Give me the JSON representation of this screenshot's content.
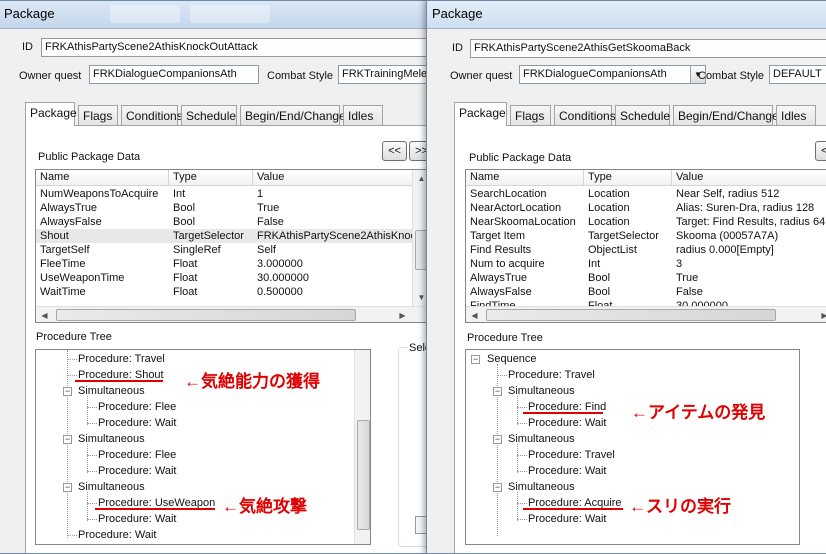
{
  "left": {
    "title": "Package",
    "id_label": "ID",
    "id_value": "FRKAthisPartyScene2AthisKnockOutAttack",
    "owner_label": "Owner quest",
    "owner_value": "FRKDialogueCompanionsAth",
    "combat_label": "Combat Style",
    "combat_value": "FRKTrainingMelee",
    "tabs": [
      "Package",
      "Flags",
      "Conditions",
      "Schedule",
      "Begin/End/Change",
      "Idles"
    ],
    "public_label": "Public Package Data",
    "nav_prev": "<<",
    "nav_next": ">>",
    "columns": [
      "Name",
      "Type",
      "Value"
    ],
    "rows": [
      [
        "NumWeaponsToAcquire",
        "Int",
        "1"
      ],
      [
        "AlwaysTrue",
        "Bool",
        "True"
      ],
      [
        "AlwaysFalse",
        "Bool",
        "False"
      ],
      [
        "Shout",
        "TargetSelector",
        "FRKAthisPartyScene2AthisKnoc..."
      ],
      [
        "TargetSelf",
        "SingleRef",
        "Self"
      ],
      [
        "FleeTime",
        "Float",
        "3.000000"
      ],
      [
        "UseWeaponTime",
        "Float",
        "30.000000"
      ],
      [
        "WaitTime",
        "Float",
        "0.500000"
      ]
    ],
    "tree_label": "Procedure Tree",
    "sel_label": "Sele",
    "tree": [
      "Procedure: Travel",
      "Procedure: Shout",
      "Simultaneous",
      "Procedure: Flee",
      "Procedure: Wait",
      "Simultaneous",
      "Procedure: Flee",
      "Procedure: Wait",
      "Simultaneous",
      "Procedure: UseWeapon",
      "Procedure: Wait",
      "Procedure: Wait"
    ],
    "annotations": [
      "←気絶能力の獲得",
      "←気絶攻撃"
    ]
  },
  "right": {
    "title": "Package",
    "id_label": "ID",
    "id_value": "FRKAthisPartyScene2AthisGetSkoomaBack",
    "owner_label": "Owner quest",
    "owner_value": "FRKDialogueCompanionsAth",
    "combat_label": "Combat Style",
    "combat_value": "DEFAULT",
    "tabs": [
      "Package",
      "Flags",
      "Conditions",
      "Schedule",
      "Begin/End/Change",
      "Idles"
    ],
    "public_label": "Public Package Data",
    "nav_prev": "<<",
    "columns": [
      "Name",
      "Type",
      "Value"
    ],
    "rows": [
      [
        "SearchLocation",
        "Location",
        "Near Self, radius 512"
      ],
      [
        "NearActorLocation",
        "Location",
        "Alias: Suren-Dra, radius 128"
      ],
      [
        "NearSkoomaLocation",
        "Location",
        "Target: Find Results, radius 64"
      ],
      [
        "Target Item",
        "TargetSelector",
        "Skooma (00057A7A)"
      ],
      [
        "Find Results",
        "ObjectList",
        "radius 0.000[Empty]"
      ],
      [
        "Num to acquire",
        "Int",
        "3"
      ],
      [
        "AlwaysTrue",
        "Bool",
        "True"
      ],
      [
        "AlwaysFalse",
        "Bool",
        "False"
      ],
      [
        "FindTime",
        "Float",
        "30.000000"
      ]
    ],
    "tree_label": "Procedure Tree",
    "tree": [
      "Sequence",
      "Procedure: Travel",
      "Simultaneous",
      "Procedure: Find",
      "Procedure: Wait",
      "Simultaneous",
      "Procedure: Travel",
      "Procedure: Wait",
      "Simultaneous",
      "Procedure: Acquire",
      "Procedure: Wait"
    ],
    "annotations": [
      "←アイテムの発見",
      "←スリの実行"
    ]
  },
  "colors": {
    "annotation": "#e00000",
    "selected_row": "#e8e8e8"
  },
  "icons": {
    "expanded": "minus-box-icon",
    "dropdown": "chevron-down-icon"
  }
}
